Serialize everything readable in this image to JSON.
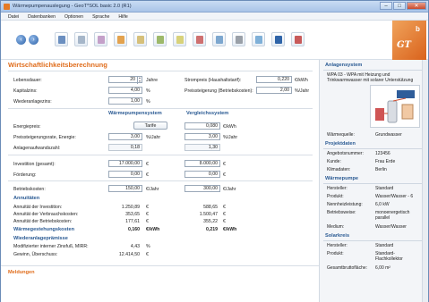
{
  "window": {
    "title": "Wärmepumpenauslegung - GeoT*SOL basic 2.0 (R1)",
    "btn_min": "–",
    "btn_max": "□",
    "btn_close": "✕"
  },
  "menu": [
    "Datei",
    "Datenbanken",
    "Optionen",
    "Sprache",
    "Hilfe"
  ],
  "toolbar": {
    "back_icon": "arrow-left-icon",
    "forward_icon": "arrow-right-icon",
    "tools": [
      "project-icon",
      "document-icon",
      "report-icon",
      "heat-pump-icon",
      "pipe-icon",
      "house-icon",
      "solar-icon",
      "tank-icon",
      "building-icon",
      "boiler-icon",
      "calendar-icon",
      "economics-icon",
      "chart-icon"
    ],
    "tool_colors": [
      "#6b8fc0",
      "#a6b6c9",
      "#c4a0c9",
      "#e3a24e",
      "#d6c07a",
      "#9db96a",
      "#d8d27a",
      "#cf7070",
      "#7da7cf",
      "#9aa0a8",
      "#7fb0d8",
      "#2f64a8",
      "#c85a5a"
    ]
  },
  "logo": {
    "text": "GT",
    "sup": "b"
  },
  "main": {
    "title": "Wirtschaftlichkeitsberechnung",
    "lebensdauer": {
      "label": "Lebensdauer:",
      "value": "20",
      "unit": "Jahre"
    },
    "kapitalzins": {
      "label": "Kapitalzins:",
      "value": "4,00",
      "unit": "%"
    },
    "wiederanlagezins": {
      "label": "Wiederanlagezins:",
      "value": "1,00",
      "unit": "%"
    },
    "strompreis": {
      "label": "Strompreis (Haushaltstarif):",
      "value": "0,220",
      "unit": "€/kWh"
    },
    "preissteigerung_betrieb": {
      "label": "Preissteigerung (Betriebskosten):",
      "value": "2,00",
      "unit": "%/Jahr"
    },
    "col_wp": "Wärmepumpensystem",
    "col_vgl": "Vergleichssystem",
    "energiepreis": {
      "label": "Energiepreis:",
      "wp": "Tarife",
      "vgl": "0,080",
      "unit": "€/kWh"
    },
    "preissteigerung_energie": {
      "label": "Preissteigerungsrate, Energie:",
      "wp": "3,00",
      "wp_unit": "%/Jahr",
      "vgl": "3,00",
      "vgl_unit": "%/Jahr"
    },
    "anlagenaufwand": {
      "label": "Anlagenaufwandszahl:",
      "wp": "0,18",
      "vgl": "1,30"
    },
    "investition": {
      "label": "Investition (gesamt):",
      "wp": "17.000,00",
      "wp_unit": "€",
      "vgl": "8.000,00",
      "vgl_unit": "€"
    },
    "foerderung": {
      "label": "Förderung:",
      "wp": "0,00",
      "wp_unit": "€",
      "vgl": "0,00",
      "vgl_unit": "€"
    },
    "betriebskosten": {
      "label": "Betriebskosten:",
      "wp": "150,00",
      "wp_unit": "€/Jahr",
      "vgl": "300,00",
      "vgl_unit": "€/Jahr"
    },
    "annuitaeten": {
      "title": "Annuitäten",
      "rows": [
        {
          "label": "Annuität der Investition:",
          "wp": "1.250,89",
          "wp_unit": "€",
          "vgl": "588,65",
          "vgl_unit": "€"
        },
        {
          "label": "Annuität der Verbrauchskosten:",
          "wp": "353,65",
          "wp_unit": "€",
          "vgl": "1.500,47",
          "vgl_unit": "€"
        },
        {
          "label": "Annuität der Betriebskosten:",
          "wp": "177,61",
          "wp_unit": "€",
          "vgl": "355,22",
          "vgl_unit": "€"
        }
      ]
    },
    "waermegestehung": {
      "label": "Wärmegestehungskosten",
      "wp": "0,160",
      "wp_unit": "€/kWh",
      "vgl": "0,219",
      "vgl_unit": "€/kWh"
    },
    "wiederanlage": {
      "title": "Wiederanlageprämisse",
      "mirr": {
        "label": "Modifizierter interner Zinsfuß, MIRR:",
        "value": "4,43",
        "unit": "%"
      },
      "gewinn": {
        "label": "Gewinn, Überschuss:",
        "value": "12.414,50",
        "unit": "€"
      }
    }
  },
  "meldungen": "Meldungen",
  "side": {
    "anlagensystem": "Anlagensystem",
    "system_desc": "WPA 03 - WPA mit Heizung und Trinkwarmwasser mit solarer Unterstützung",
    "waermequelle": {
      "k": "Wärmequelle:",
      "v": "Grundwasser"
    },
    "projektdaten": "Projektdaten",
    "angebot": {
      "k": "Angebotsnummer:",
      "v": "123456"
    },
    "kunde": {
      "k": "Kunde:",
      "v": "Frau Erde"
    },
    "klima": {
      "k": "Klimadaten:",
      "v": "Berlin"
    },
    "waermepumpe": "Wärmepumpe",
    "wp_hersteller": {
      "k": "Hersteller:",
      "v": "Standard"
    },
    "wp_produkt": {
      "k": "Produkt:",
      "v": "Wasser/Wasser - 6"
    },
    "nennheiz": {
      "k": "Nennheizleistung:",
      "v": "6,0 kW"
    },
    "betriebsweise": {
      "k": "Betriebsweise:",
      "v": "monoenergetisch parallel"
    },
    "medium": {
      "k": "Medium:",
      "v": "Wasser/Wasser"
    },
    "solarkreis": "Solarkreis",
    "sk_hersteller": {
      "k": "Hersteller:",
      "v": "Standard"
    },
    "sk_produkt": {
      "k": "Produkt:",
      "v": "Standard-Flachkollektor"
    },
    "bruttoflaeche": {
      "k": "Gesamtbruttofläche:",
      "v": "6,00 m²"
    }
  }
}
